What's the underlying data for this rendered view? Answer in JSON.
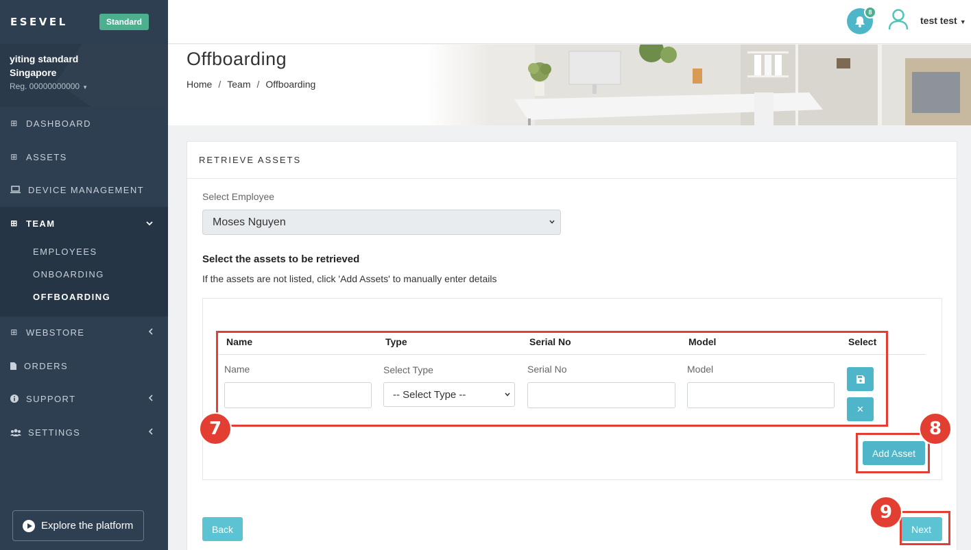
{
  "app": {
    "logo": "ESEVEL",
    "plan_badge": "Standard"
  },
  "company": {
    "name_line1": "yiting standard",
    "name_line2": "Singapore",
    "reg": "Reg. 00000000000"
  },
  "sidebar": {
    "items": [
      {
        "label": "DASHBOARD",
        "icon": "grid-icon"
      },
      {
        "label": "ASSETS",
        "icon": "grid-icon"
      },
      {
        "label": "DEVICE MANAGEMENT",
        "icon": "laptop-icon"
      },
      {
        "label": "TEAM",
        "icon": "grid-icon"
      },
      {
        "label": "WEBSTORE",
        "icon": "grid-icon"
      },
      {
        "label": "ORDERS",
        "icon": "file-icon"
      },
      {
        "label": "SUPPORT",
        "icon": "info-icon"
      },
      {
        "label": "SETTINGS",
        "icon": "users-icon"
      }
    ],
    "team_sub": [
      "EMPLOYEES",
      "ONBOARDING",
      "OFFBOARDING"
    ],
    "explore_label": "Explore the platform"
  },
  "topbar": {
    "notification_count": "8",
    "user_name": "test test"
  },
  "page": {
    "title": "Offboarding",
    "breadcrumb": [
      "Home",
      "Team",
      "Offboarding"
    ]
  },
  "card": {
    "title": "RETRIEVE ASSETS",
    "employee_label": "Select Employee",
    "employee_value": "Moses Nguyen",
    "section_heading": "Select the assets to be retrieved",
    "section_hint": "If the assets are not listed, click 'Add Assets' to manually enter details"
  },
  "table": {
    "headers": [
      "Name",
      "Type",
      "Serial No",
      "Model",
      "Select"
    ],
    "field_labels": {
      "name": "Name",
      "type": "Select Type",
      "serial": "Serial No",
      "model": "Model"
    },
    "type_select_value": "-- Select Type --"
  },
  "buttons": {
    "add_asset": "Add Asset",
    "back": "Back",
    "next": "Next"
  },
  "annotations": {
    "step_7": "7",
    "step_8": "8",
    "step_9": "9",
    "color": "#e23e32"
  }
}
